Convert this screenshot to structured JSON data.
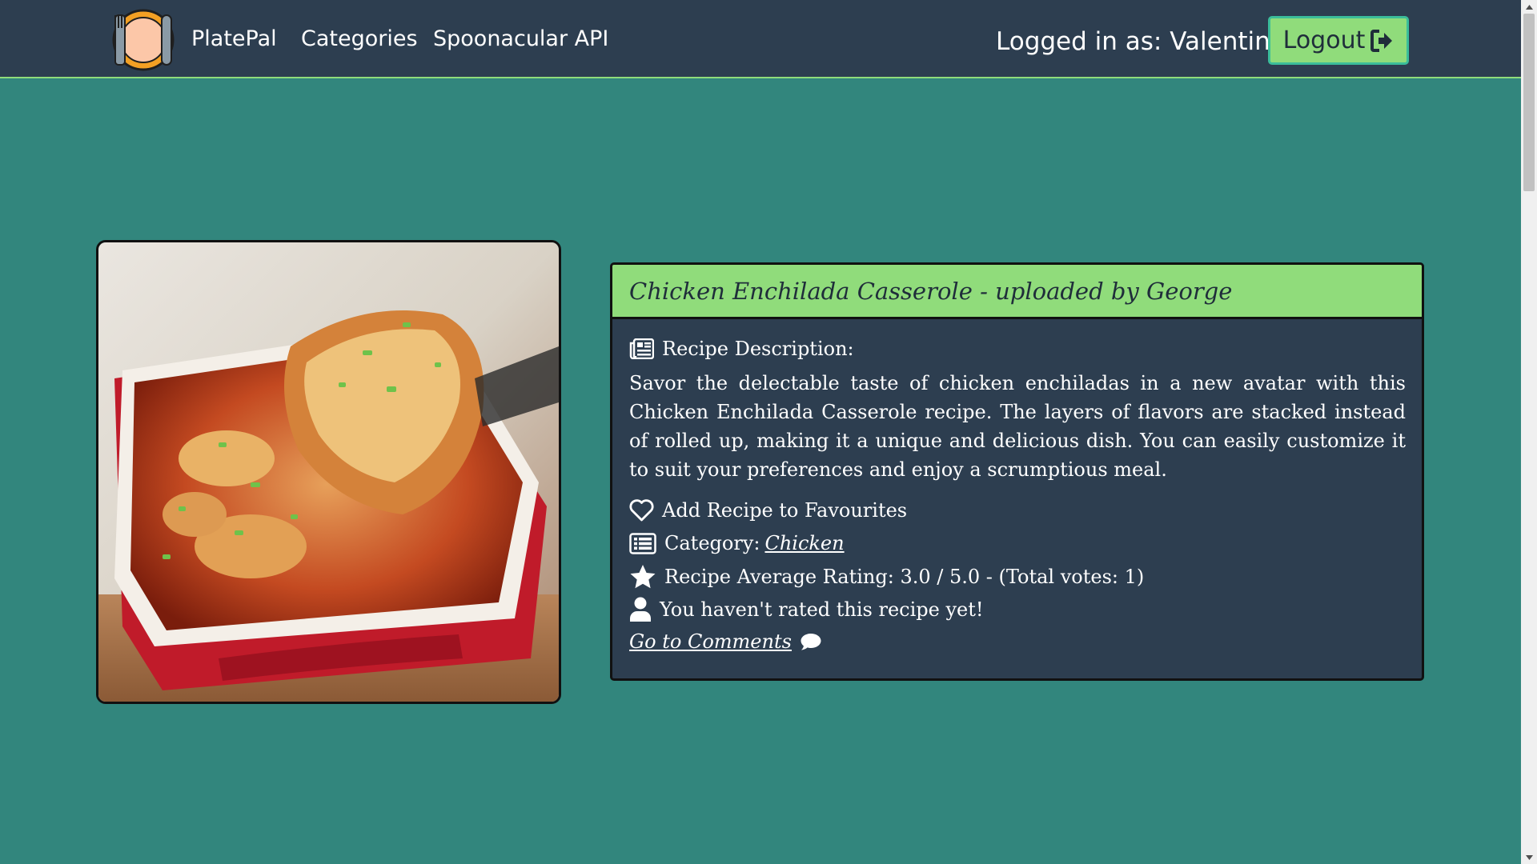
{
  "navbar": {
    "brand": "PlatePal",
    "links": [
      "Categories",
      "Spoonacular API"
    ],
    "logged_in_text": "Logged in as: Valentin",
    "logout_label": "Logout",
    "logout_icon": "sign-out-icon",
    "background": "#2d3e50",
    "accent": "#90dc7b"
  },
  "page": {
    "background": "#32867d"
  },
  "recipe": {
    "title": "Chicken Enchilada Casserole - uploaded by George",
    "image_alt": "Chicken Enchilada Casserole",
    "description_heading": "Recipe Description:",
    "description": "Savor the delectable taste of chicken enchiladas in a new avatar with this Chicken Enchilada Casserole recipe. The layers of flavors are stacked instead of rolled up, making it a unique and delicious dish. You can easily customize it to suit your preferences and enjoy a scrumptious meal.",
    "favourite_label": "Add Recipe to Favourites",
    "category_label": "Category:",
    "category_value": "Chicken",
    "rating_text": "Recipe Average Rating: 3.0 / 5.0 - (Total votes: 1)",
    "user_rating_text": "You haven't rated this recipe yet!",
    "comments_link": "Go to Comments",
    "icons": {
      "description": "newspaper-icon",
      "favourite": "heart-outline-icon",
      "category": "list-icon",
      "rating": "star-icon",
      "user": "user-icon",
      "comments": "comment-icon"
    }
  }
}
